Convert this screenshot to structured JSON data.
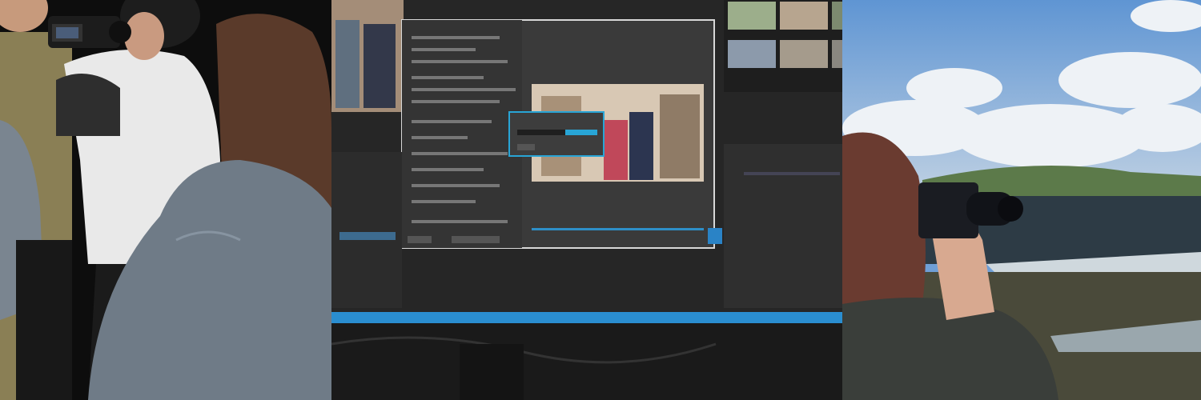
{
  "collage": {
    "panels": [
      {
        "id": "studio",
        "icon": "video-camera-icon"
      },
      {
        "id": "editing",
        "icon": "monitor-icon"
      },
      {
        "id": "photography",
        "icon": "photo-camera-icon"
      }
    ],
    "colors": {
      "editor_accent": "#28a5d6",
      "taskbar": "#2a8ed0",
      "sky": "#6f9fd6",
      "sea": "#2d3b45"
    }
  }
}
